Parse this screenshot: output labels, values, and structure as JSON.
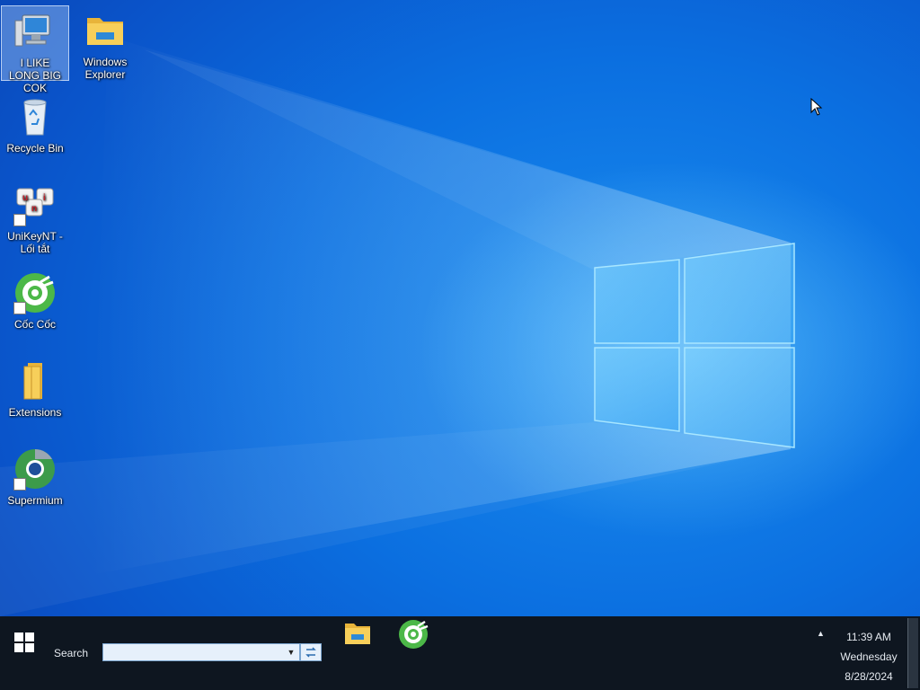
{
  "desktop": {
    "icons": [
      {
        "id": "this-pc",
        "label": "I LIKE LONG BIG COK",
        "icon": "computer-icon"
      },
      {
        "id": "windows-explorer",
        "label": "Windows Explorer",
        "icon": "folder-icon"
      },
      {
        "id": "recycle-bin",
        "label": "Recycle Bin",
        "icon": "recycle-bin-icon"
      },
      {
        "id": "unikey",
        "label": "UniKeyNT - Lối tắt",
        "icon": "unikey-icon"
      },
      {
        "id": "coccoc",
        "label": "Cốc Cốc",
        "icon": "coccoc-icon"
      },
      {
        "id": "extensions",
        "label": "Extensions",
        "icon": "folder-icon"
      },
      {
        "id": "supermium",
        "label": "Supermium",
        "icon": "supermium-icon"
      }
    ]
  },
  "taskbar": {
    "search_label": "Search",
    "search_value": "",
    "pinned": [
      {
        "label": "Windows Explorer",
        "icon": "folder-icon"
      },
      {
        "label": "Cốc Cốc",
        "icon": "coccoc-icon"
      }
    ],
    "clock": {
      "time": "11:39 AM",
      "day": "Wednesday",
      "date": "8/28/2024"
    }
  },
  "colors": {
    "wallpaper": "#0b6fe0",
    "taskbar": "#0e1620",
    "search_box": "#e6f0fb"
  }
}
